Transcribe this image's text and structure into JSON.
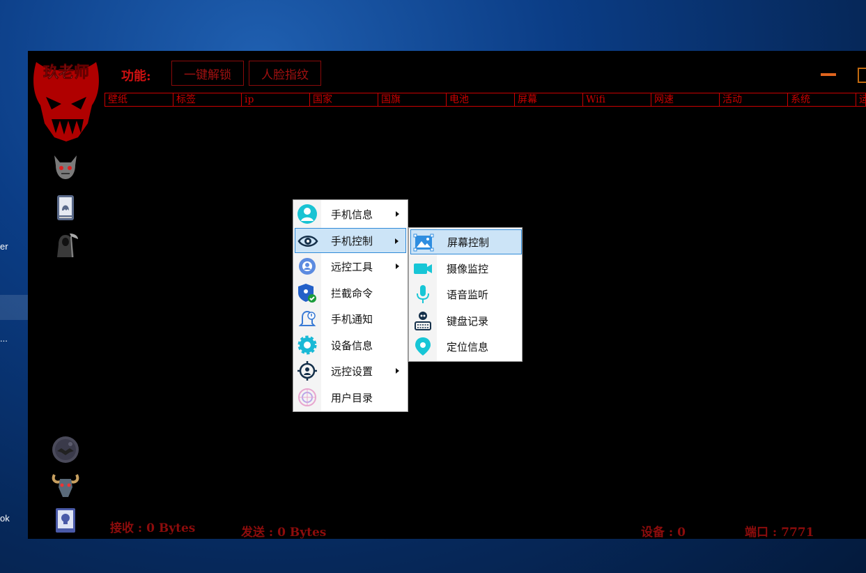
{
  "desktop": {
    "fragments": [
      "er",
      "...",
      "ok"
    ]
  },
  "app": {
    "logo_text": "玖老师",
    "func_label": "功能:",
    "buttons": [
      {
        "label": "一键解锁"
      },
      {
        "label": "人脸指纹"
      }
    ],
    "columns": [
      "壁纸",
      "标签",
      "ip",
      "国家",
      "国旗",
      "电池",
      "屏幕",
      "Wifi",
      "网速",
      "活动",
      "系统",
      "运"
    ],
    "status": {
      "receive": "接收 : 0 Bytes",
      "send": "发送 : 0 Bytes",
      "devices": "设备 : 0",
      "port": "端口 : 7771"
    }
  },
  "context_menu": {
    "items": [
      {
        "label": "手机信息",
        "icon": "person-icon",
        "submenu": true
      },
      {
        "label": "手机控制",
        "icon": "eye-icon",
        "submenu": true,
        "highlighted": true
      },
      {
        "label": "远控工具",
        "icon": "gear-person-icon",
        "submenu": true
      },
      {
        "label": "拦截命令",
        "icon": "shield-check-icon",
        "submenu": false
      },
      {
        "label": "手机通知",
        "icon": "bell-icon",
        "submenu": false
      },
      {
        "label": "设备信息",
        "icon": "cog-icon",
        "submenu": false
      },
      {
        "label": "远控设置",
        "icon": "target-icon",
        "submenu": true
      },
      {
        "label": "用户目录",
        "icon": "folder-icon",
        "submenu": false
      }
    ]
  },
  "submenu": {
    "items": [
      {
        "label": "屏幕控制",
        "icon": "screen-icon",
        "highlighted": true
      },
      {
        "label": "摄像监控",
        "icon": "camera-icon"
      },
      {
        "label": "语音监听",
        "icon": "microphone-icon"
      },
      {
        "label": "键盘记录",
        "icon": "keyboard-icon"
      },
      {
        "label": "定位信息",
        "icon": "location-pin-icon"
      }
    ]
  },
  "colors": {
    "accent_red": "#c00000",
    "menu_highlight": "#cce4f7",
    "icon_teal": "#17c6d6"
  }
}
